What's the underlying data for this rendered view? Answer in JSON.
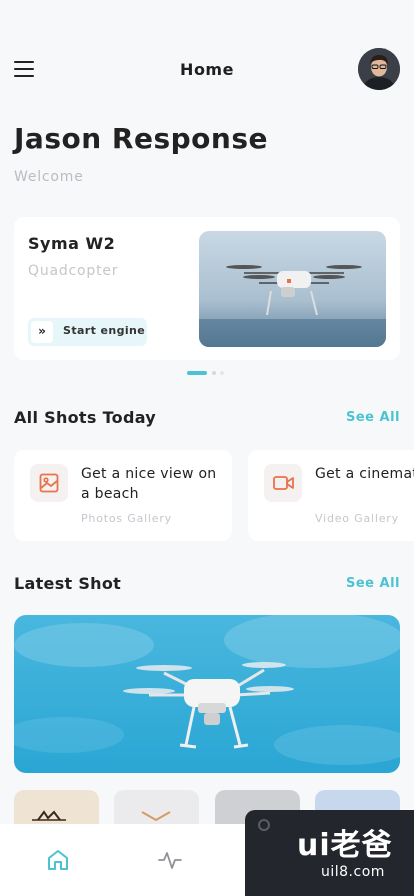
{
  "header": {
    "title": "Home",
    "menu_icon": "hamburger-menu-icon",
    "avatar_icon": "user-avatar"
  },
  "greeting": {
    "name": "Jason Response",
    "subtitle": "Welcome"
  },
  "featured_drone": {
    "name": "Syma W2",
    "type": "Quadcopter",
    "action_label": "Start engine",
    "action_icon": "double-chevron-right-icon",
    "carousel_pages": 3,
    "carousel_active": 1
  },
  "all_shots": {
    "title": "All Shots Today",
    "see_all": "See All",
    "items": [
      {
        "title": "Get a nice view on a beach",
        "subtitle": "Photos Gallery",
        "icon": "image-icon"
      },
      {
        "title": "Get a cinematic video to",
        "subtitle": "Video Gallery",
        "icon": "video-camera-icon"
      }
    ]
  },
  "latest_shot": {
    "title": "Latest Shot",
    "see_all": "See All"
  },
  "bottom_nav": {
    "items": [
      {
        "icon": "home-icon",
        "active": true
      },
      {
        "icon": "activity-icon",
        "active": false
      }
    ]
  },
  "watermark": {
    "logo": "ui老爸",
    "url": "uil8.com"
  },
  "colors": {
    "accent": "#4cc3d2",
    "icon_orange": "#e8734a",
    "background": "#f7f8fa"
  }
}
